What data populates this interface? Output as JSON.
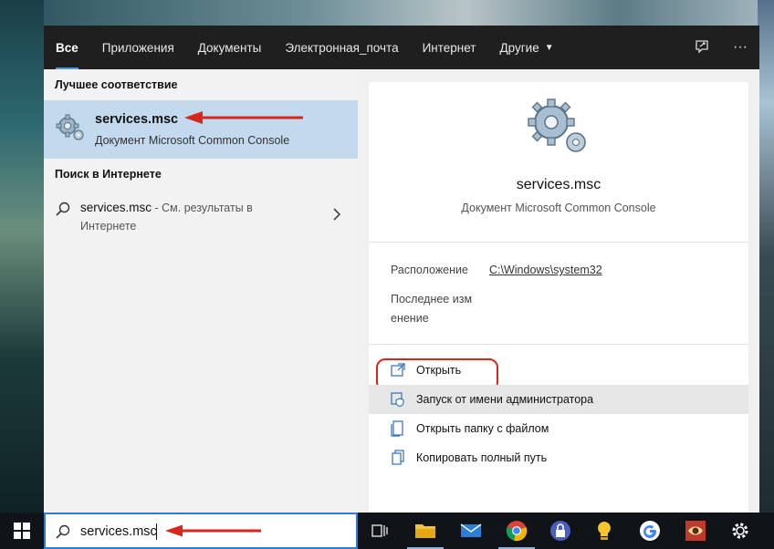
{
  "tabs": {
    "items": [
      "Все",
      "Приложения",
      "Документы",
      "Электронная_почта",
      "Интернет",
      "Другие"
    ],
    "active_index": 0
  },
  "tab_icons": [
    "feedback-icon",
    "more-icon"
  ],
  "tab_more_glyph": "···",
  "left": {
    "best_match_title": "Лучшее соответствие",
    "best_match": {
      "name": "services.msc",
      "subtitle": "Документ Microsoft Common Console",
      "icon": "gears-icon"
    },
    "web_title": "Поиск в Интернете",
    "web_result": {
      "query": "services.msc",
      "suffix": " - См. результаты в Интернете",
      "icon": "search-icon"
    }
  },
  "preview": {
    "name": "services.msc",
    "subtitle": "Документ Microsoft Common Console",
    "icon": "gears-icon",
    "location_label": "Расположение",
    "location_value": "C:\\Windows\\system32",
    "modified_label": "Последнее изм енение"
  },
  "actions": [
    {
      "label": "Открыть",
      "icon": "open-icon",
      "highlighted": true
    },
    {
      "label": "Запуск от имени администратора",
      "icon": "shield-icon",
      "hover": true
    },
    {
      "label": "Открыть папку с файлом",
      "icon": "folder-icon"
    },
    {
      "label": "Копировать полный путь",
      "icon": "copy-icon"
    }
  ],
  "taskbar": {
    "search_value": "services.msc",
    "apps": [
      "task-view-icon",
      "file-explorer-icon",
      "mail-icon",
      "chrome-icon",
      "keepass-icon",
      "tips-icon",
      "google-icon",
      "app-icon",
      "settings-icon"
    ]
  },
  "colors": {
    "accent": "#4c9be8",
    "selection": "#c3d9ed",
    "annotation_red": "#d9261c",
    "tabbar": "#1f1f1f"
  }
}
